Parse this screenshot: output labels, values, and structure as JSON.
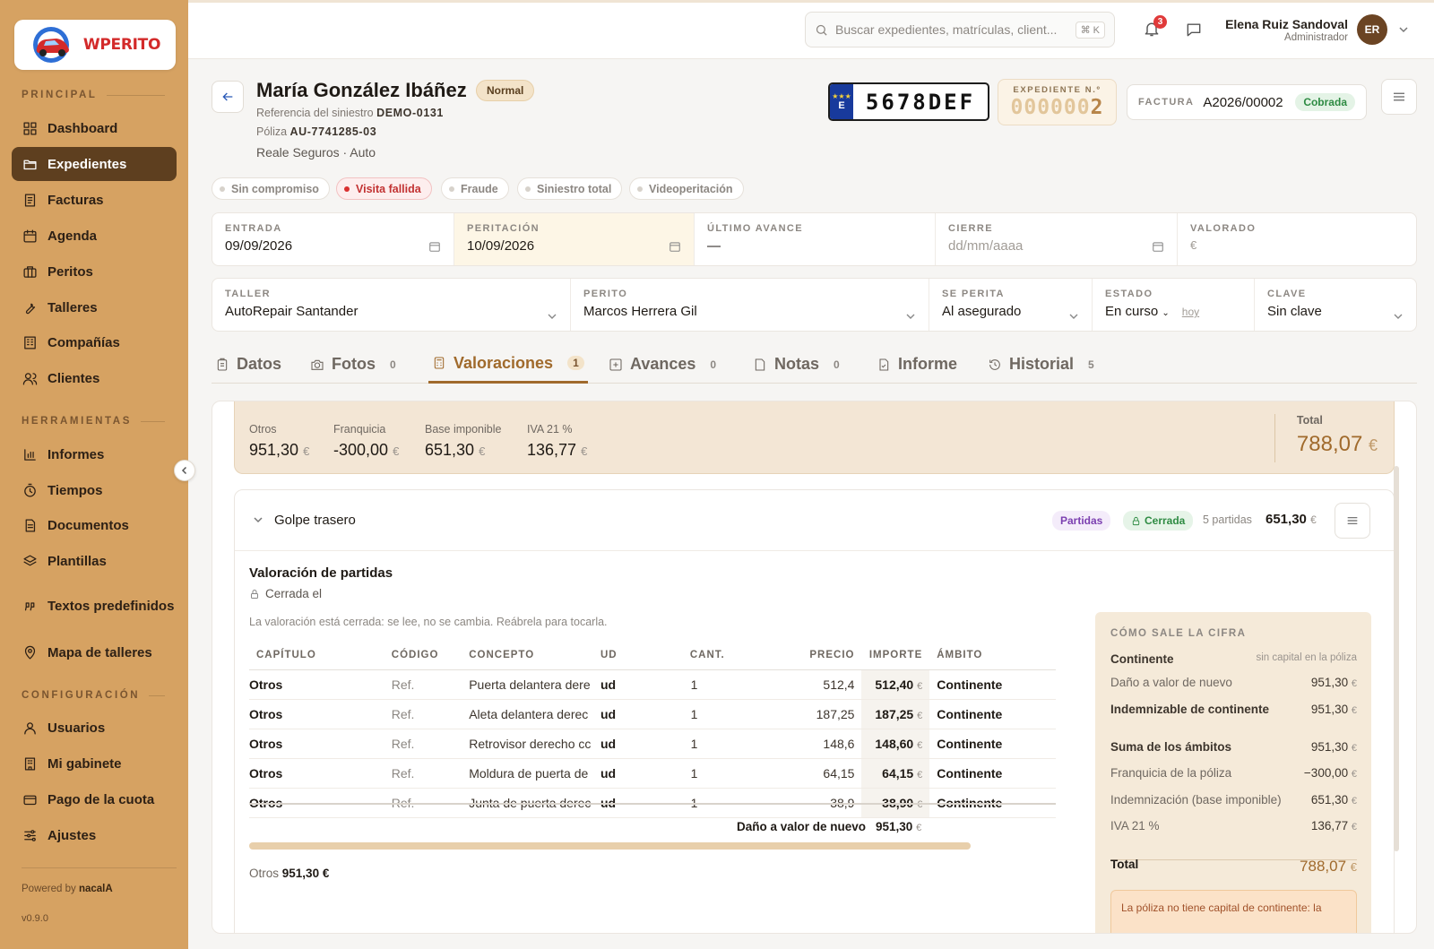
{
  "app": {
    "logo_text": "WPERITO",
    "powered_prefix": "Powered by",
    "powered_brand": "nacalA",
    "version": "v0.9.0"
  },
  "sidebar": {
    "sections": [
      {
        "title": "PRINCIPAL",
        "items": [
          "Dashboard",
          "Expedientes",
          "Facturas",
          "Agenda",
          "Peritos",
          "Talleres",
          "Compañías",
          "Clientes"
        ]
      },
      {
        "title": "HERRAMIENTAS",
        "items": [
          "Informes",
          "Tiempos",
          "Documentos",
          "Plantillas",
          "Textos predefinidos",
          "Mapa de talleres"
        ]
      },
      {
        "title": "CONFIGURACIÓN",
        "items": [
          "Usuarios",
          "Mi gabinete",
          "Pago de la cuota",
          "Ajustes"
        ]
      }
    ],
    "active": "Expedientes"
  },
  "topbar": {
    "search_placeholder": "Buscar expedientes, matrículas, client...",
    "search_shortcut": "⌘ K",
    "notifications": "3",
    "user_name": "Elena Ruiz Sandoval",
    "user_role": "Administrador",
    "user_initials": "ER"
  },
  "case": {
    "name": "María González Ibáñez",
    "priority": "Normal",
    "ref_label": "Referencia del siniestro",
    "ref_value": "DEMO-0131",
    "policy_label": "Póliza",
    "policy_value": "AU-7741285-03",
    "company": "Reale Seguros · Auto",
    "plate_country": "E",
    "plate": "5678DEF",
    "exp_label": "EXPEDIENTE N.º",
    "exp_prefix": "000000",
    "exp_number": "2",
    "invoice_label": "FACTURA",
    "invoice_value": "A2026/00002",
    "invoice_status": "Cobrada"
  },
  "flags": [
    {
      "label": "Sin compromiso",
      "on": false
    },
    {
      "label": "Visita fallida",
      "on": true
    },
    {
      "label": "Fraude",
      "on": false
    },
    {
      "label": "Siniestro total",
      "on": false
    },
    {
      "label": "Videoperitación",
      "on": false
    }
  ],
  "dates": {
    "entrada": {
      "label": "ENTRADA",
      "value": "09/09/2026"
    },
    "peritacion": {
      "label": "PERITACIÓN",
      "value": "10/09/2026"
    },
    "ultimo": {
      "label": "ÚLTIMO AVANCE",
      "value": "—"
    },
    "cierre": {
      "label": "CIERRE",
      "placeholder": "dd/mm/aaaa"
    },
    "valorado": {
      "label": "VALORADO",
      "placeholder": "€"
    }
  },
  "fields": {
    "taller": {
      "label": "TALLER",
      "value": "AutoRepair Santander"
    },
    "perito": {
      "label": "PERITO",
      "value": "Marcos Herrera Gil"
    },
    "se_perita": {
      "label": "SE PERITA",
      "value": "Al asegurado"
    },
    "estado": {
      "label": "ESTADO",
      "value": "En curso",
      "hoy": "hoy"
    },
    "clave": {
      "label": "CLAVE",
      "value": "Sin clave"
    }
  },
  "tabs": [
    {
      "label": "Datos",
      "count": ""
    },
    {
      "label": "Fotos",
      "count": "0"
    },
    {
      "label": "Valoraciones",
      "count": "1"
    },
    {
      "label": "Avances",
      "count": "0"
    },
    {
      "label": "Notas",
      "count": "0"
    },
    {
      "label": "Informe",
      "count": ""
    },
    {
      "label": "Historial",
      "count": "5"
    }
  ],
  "summary": {
    "items": [
      {
        "label": "Otros",
        "value": "951,30"
      },
      {
        "label": "Franquicia",
        "value": "-300,00"
      },
      {
        "label": "Base imponible",
        "value": "651,30"
      },
      {
        "label": "IVA 21 %",
        "value": "136,77"
      }
    ],
    "total_label": "Total",
    "total_value": "788,07",
    "currency": "€"
  },
  "group": {
    "title": "Golpe trasero",
    "tag_type": "Partidas",
    "tag_status": "Cerrada",
    "parts": "5 partidas",
    "amount": "651,30",
    "val_title": "Valoración de partidas",
    "val_sub": "Cerrada el",
    "val_note": "La valoración está cerrada: se lee, no se cambia. Reábrela para tocarla.",
    "columns": [
      "CAPÍTULO",
      "CÓDIGO",
      "CONCEPTO",
      "UD",
      "CANT.",
      "PRECIO",
      "IMPORTE",
      "ÁMBITO"
    ],
    "rows": [
      [
        "Otros",
        "Ref.",
        "Puerta delantera dere",
        "ud",
        "1",
        "512,4",
        "512,40",
        "Continente"
      ],
      [
        "Otros",
        "Ref.",
        "Aleta delantera derec",
        "ud",
        "1",
        "187,25",
        "187,25",
        "Continente"
      ],
      [
        "Otros",
        "Ref.",
        "Retrovisor derecho cc",
        "ud",
        "1",
        "148,6",
        "148,60",
        "Continente"
      ],
      [
        "Otros",
        "Ref.",
        "Moldura de puerta de",
        "ud",
        "1",
        "64,15",
        "64,15",
        "Continente"
      ],
      [
        "Otros",
        "Ref.",
        "Junta de puerta derec",
        "ud",
        "1",
        "38,9",
        "38,90",
        "Continente"
      ]
    ],
    "footer_label": "Daño a valor de nuevo",
    "footer_value": "951,30",
    "otros_label": "Otros",
    "otros_value": "951,30 €"
  },
  "calc": {
    "title": "CÓMO SALE LA CIFRA",
    "section": "Continente",
    "section_note": "sin capital en la póliza",
    "rows": [
      {
        "label": "Daño a valor de nuevo",
        "value": "951,30"
      },
      {
        "label": "Indemnizable de continente",
        "value": "951,30"
      },
      {
        "label": "Suma de los ámbitos",
        "value": "951,30"
      },
      {
        "label": "Franquicia de la póliza",
        "value": "−300,00"
      },
      {
        "label": "Indemnización (base imponible)",
        "value": "651,30"
      },
      {
        "label": "IVA 21 %",
        "value": "136,77"
      }
    ],
    "total_label": "Total",
    "total_value": "788,07",
    "alert": "La póliza no tiene capital de continente: la"
  }
}
